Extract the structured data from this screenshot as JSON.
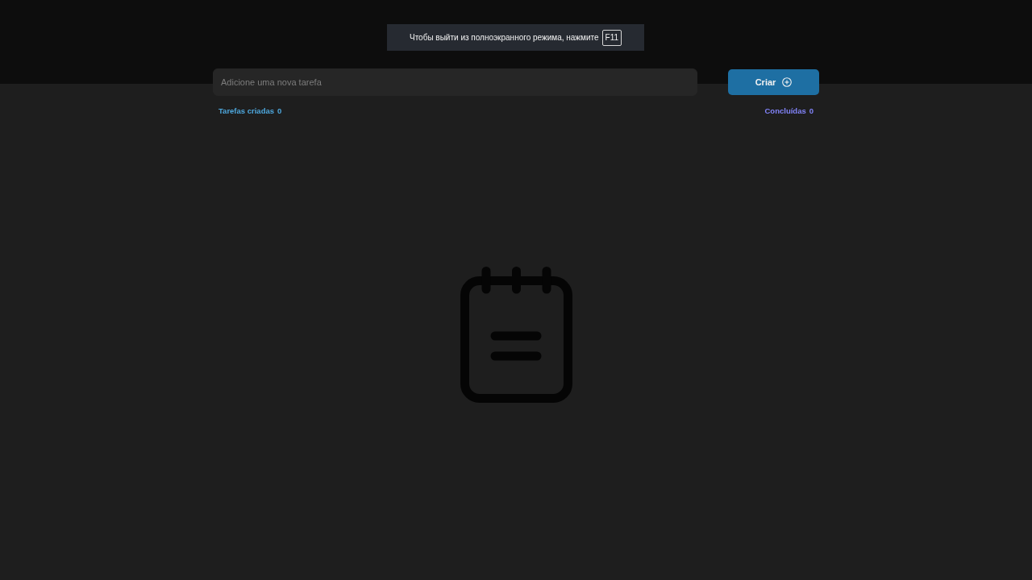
{
  "fullscreen_notice": {
    "message": "Чтобы выйти из полноэкранного режима, нажмите",
    "key": "F11"
  },
  "new_task": {
    "placeholder": "Adicione uma nova tarefa",
    "button": "Criar"
  },
  "counters": [
    {
      "kind": "created",
      "label": "Tarefas criadas",
      "count": "0"
    },
    {
      "kind": "done",
      "label": "Concluídas",
      "count": "0"
    }
  ]
}
